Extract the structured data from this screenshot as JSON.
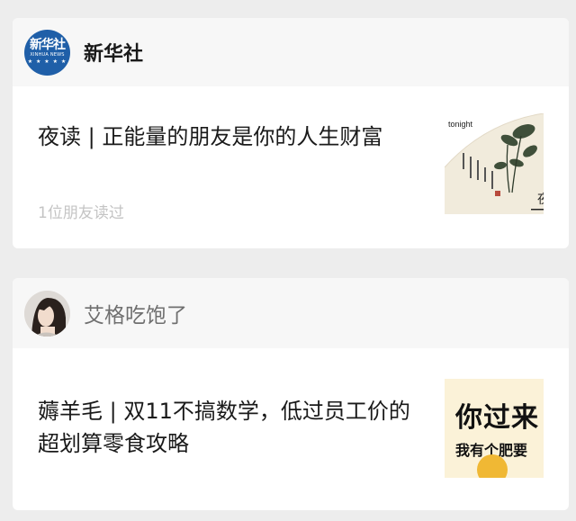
{
  "feed": [
    {
      "source": {
        "name": "新华社",
        "logo_text": "新华社",
        "logo_sub": "XINHUA NEWS",
        "logo_stars": "★ ★ ★ ★ ★"
      },
      "article": {
        "title": "夜读 | 正能量的朋友是你的人生财富",
        "meta": "1位朋友读过"
      },
      "thumbnail": {
        "caption": "tonight"
      }
    },
    {
      "source": {
        "name": "艾格吃饱了"
      },
      "article": {
        "title": "薅羊毛 | 双11不搞数学，低过员工价的超划算零食攻略"
      },
      "thumbnail": {
        "line1": "你过来",
        "line2": "我有个肥要"
      }
    }
  ],
  "colors": {
    "background": "#ededed",
    "card": "#ffffff",
    "header": "#f7f7f7",
    "title_text": "#1a1a1a",
    "meta_text": "#c4c4c4",
    "xinhua_blue": "#1f5fa8"
  }
}
